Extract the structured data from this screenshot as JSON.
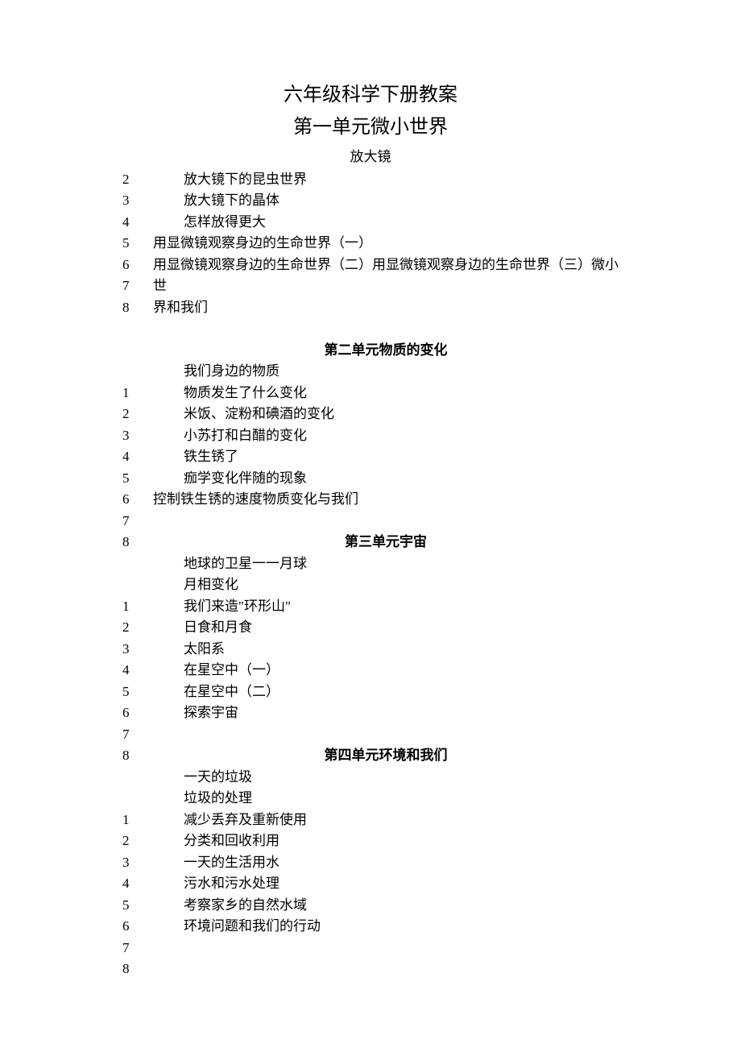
{
  "title_main": "六年级科学下册教案",
  "title_sub": "第一单元微小世界",
  "item_first": "放大镜",
  "block1": {
    "numbers": [
      "2",
      "3",
      "4",
      "5",
      "6",
      "7",
      "8"
    ],
    "lines": [
      {
        "text": "放大镜下的昆虫世界",
        "cls": "indented"
      },
      {
        "text": "放大镜下的晶体",
        "cls": "indented"
      },
      {
        "text": "怎样放得更大",
        "cls": "indented"
      },
      {
        "text": "用显微镜观察身边的生命世界（一）",
        "cls": "flush"
      },
      {
        "text": "用显微镜观察身边的生命世界（二）用显微镜观察身边的生命世界（三）微小世",
        "cls": "flush"
      },
      {
        "text": "界和我们",
        "cls": "flush"
      },
      {
        "text": "",
        "cls": "flush"
      },
      {
        "text": "第二单元物质的变化",
        "cls": "unit-heading"
      },
      {
        "text": "我们身边的物质",
        "cls": "indented"
      }
    ]
  },
  "block2": {
    "numbers": [
      "1",
      "2",
      "3",
      "4",
      "5",
      "6",
      "7",
      "8"
    ],
    "lines": [
      {
        "text": "物质发生了什么变化",
        "cls": "indented"
      },
      {
        "text": "米饭、淀粉和碘酒的变化",
        "cls": "indented"
      },
      {
        "text": "小苏打和白醋的变化",
        "cls": "indented"
      },
      {
        "text": "铁生锈了",
        "cls": "indented"
      },
      {
        "text": "痂学变化伴随的现象",
        "cls": "indented"
      },
      {
        "text": "控制铁生锈的速度物质变化与我们",
        "cls": "flush"
      },
      {
        "text": "",
        "cls": "flush"
      },
      {
        "text": "第三单元宇宙",
        "cls": "unit-heading"
      },
      {
        "text": "地球的卫星一一月球",
        "cls": "indented"
      },
      {
        "text": "月相变化",
        "cls": "indented"
      }
    ]
  },
  "block3": {
    "numbers": [
      "1",
      "2",
      "3",
      "4",
      "5",
      "6",
      "7",
      "8"
    ],
    "lines": [
      {
        "text": "我们来造\"环形山\"",
        "cls": "indented"
      },
      {
        "text": "日食和月食",
        "cls": "indented"
      },
      {
        "text": "太阳系",
        "cls": "indented"
      },
      {
        "text": "在星空中（一）",
        "cls": "indented"
      },
      {
        "text": "在星空中（二）",
        "cls": "indented"
      },
      {
        "text": "探索宇宙",
        "cls": "indented"
      },
      {
        "text": "",
        "cls": "flush"
      },
      {
        "text": "第四单元环境和我们",
        "cls": "unit-heading"
      },
      {
        "text": "一天的垃圾",
        "cls": "indented"
      },
      {
        "text": "垃圾的处理",
        "cls": "indented"
      }
    ]
  },
  "block4": {
    "numbers": [
      "1",
      "2",
      "3",
      "4",
      "5",
      "6",
      "7",
      "8"
    ],
    "lines": [
      {
        "text": "减少丢弃及重新使用",
        "cls": "indented"
      },
      {
        "text": "分类和回收利用",
        "cls": "indented"
      },
      {
        "text": "一天的生活用水",
        "cls": "indented"
      },
      {
        "text": "污水和污水处理",
        "cls": "indented"
      },
      {
        "text": "考察家乡的自然水域",
        "cls": "indented"
      },
      {
        "text": "环境问题和我们的行动",
        "cls": "indented"
      },
      {
        "text": "",
        "cls": "flush"
      },
      {
        "text": "",
        "cls": "flush"
      }
    ]
  }
}
